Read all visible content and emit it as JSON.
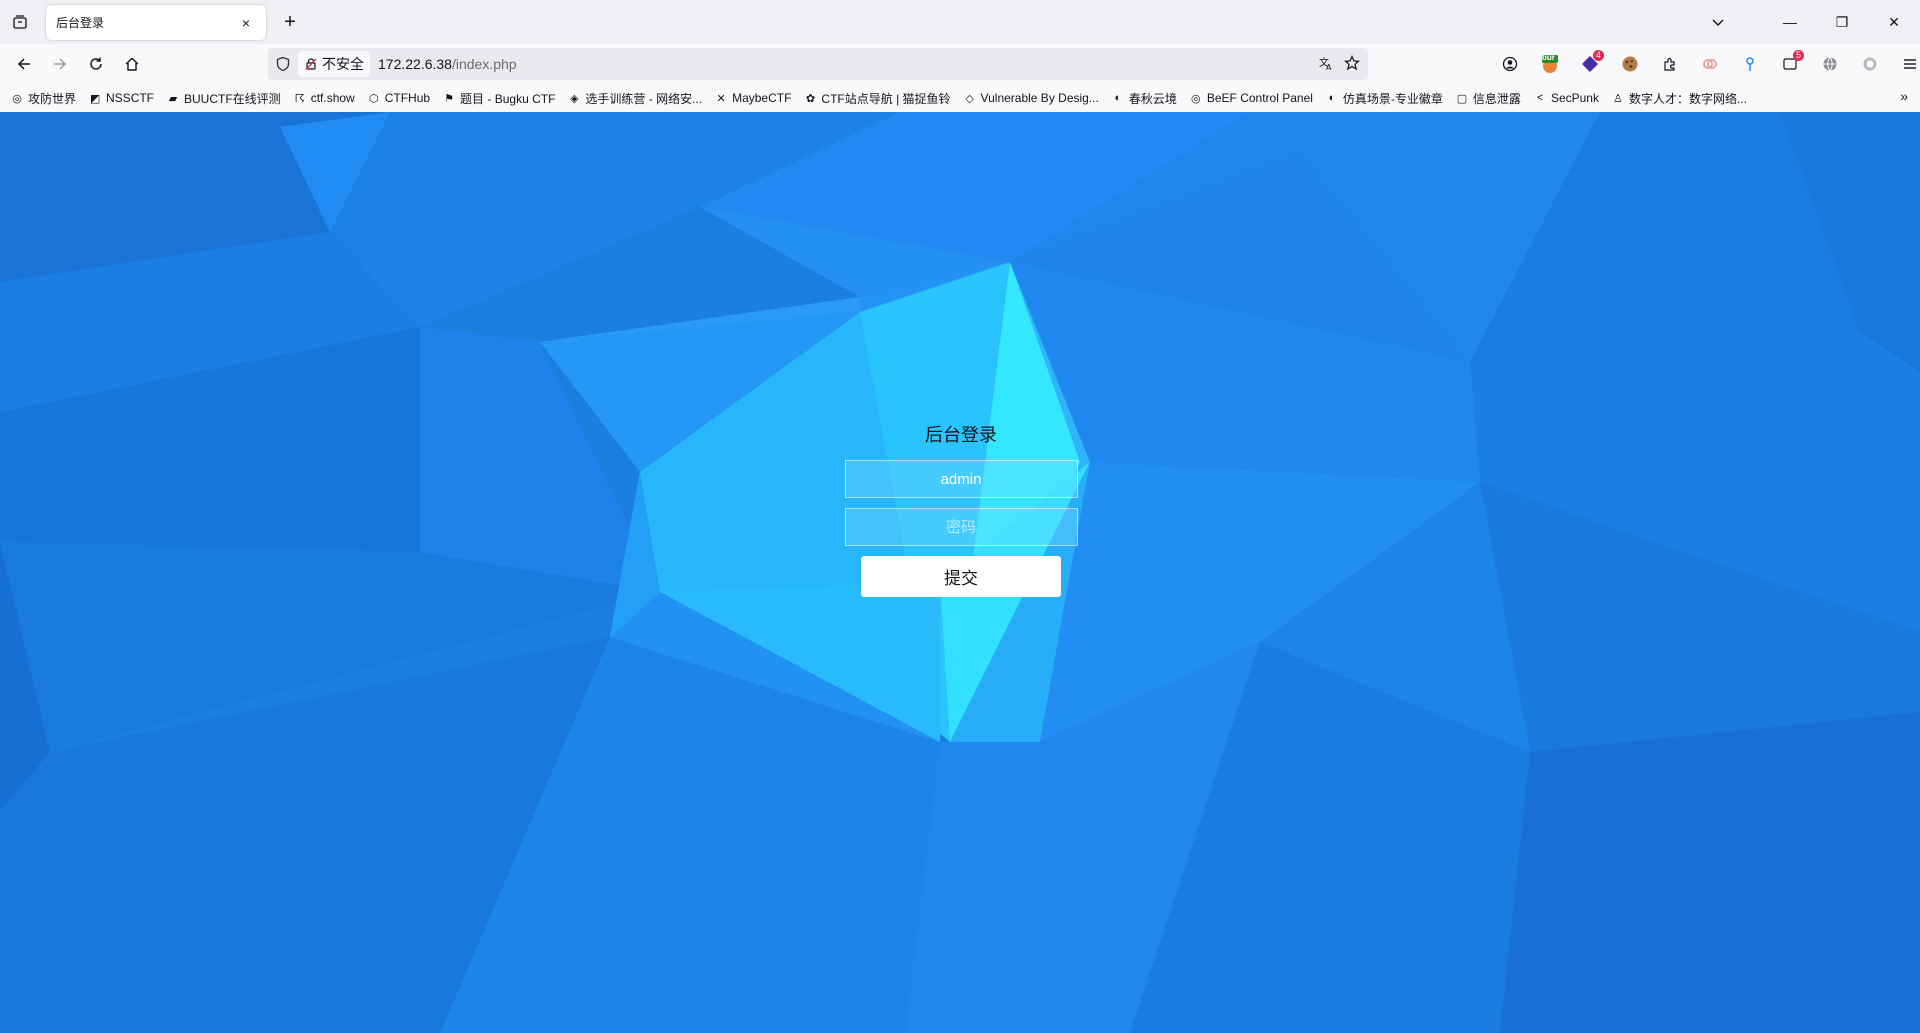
{
  "tab": {
    "title": "后台登录",
    "close": "×",
    "new_tab": "+"
  },
  "window_controls": {
    "minimize": "—",
    "restore": "❐",
    "close": "✕"
  },
  "urlbar": {
    "security_label": "不安全",
    "host": "172.22.6.38",
    "path": "/index.php"
  },
  "extensions": {
    "burp_label": "bur",
    "badge_4": "4",
    "badge_5": "5"
  },
  "bookmarks": [
    {
      "label": "攻防世界",
      "icon": "globe-icon"
    },
    {
      "label": "NSSCTF",
      "icon": "nss-icon"
    },
    {
      "label": "BUUCTF在线评测",
      "icon": "buu-icon"
    },
    {
      "label": "ctf.show",
      "icon": "runner-icon"
    },
    {
      "label": "CTFHub",
      "icon": "hub-icon"
    },
    {
      "label": "题目 - Bugku CTF",
      "icon": "flag-icon"
    },
    {
      "label": "选手训练营 - 网络安...",
      "icon": "shield-icon"
    },
    {
      "label": "MaybeCTF",
      "icon": "maybe-icon"
    },
    {
      "label": "CTF站点导航 | 猫捉鱼铃",
      "icon": "cat-icon"
    },
    {
      "label": "Vulnerable By Desig...",
      "icon": "cube-icon"
    },
    {
      "label": "春秋云境",
      "icon": "spiral-icon"
    },
    {
      "label": "BeEF Control Panel",
      "icon": "globe-icon"
    },
    {
      "label": "仿真场景-专业徽章",
      "icon": "spiral-icon"
    },
    {
      "label": "信息泄露",
      "icon": "square-icon"
    },
    {
      "label": "SecPunk",
      "icon": "code-icon"
    },
    {
      "label": "数字人才：数字网络...",
      "icon": "people-icon"
    }
  ],
  "login": {
    "title": "后台登录",
    "username_value": "admin",
    "password_placeholder": "密码",
    "submit_label": "提交"
  },
  "colors": {
    "page_base": "#1b7fe0",
    "highlight": "#33f0ff"
  }
}
